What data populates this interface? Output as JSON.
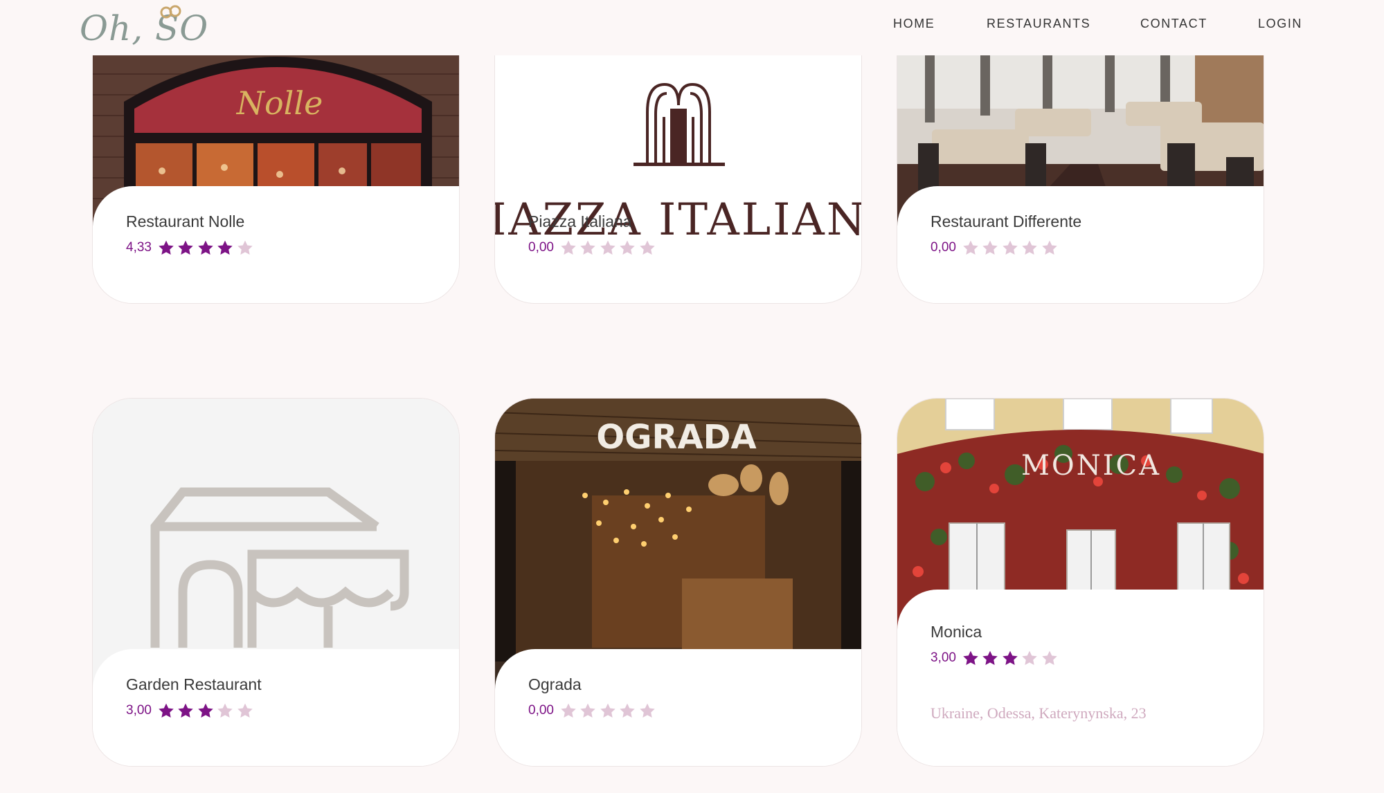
{
  "header": {
    "logo_text": "Oh, SO",
    "nav": [
      "HOME",
      "RESTAURANTS",
      "CONTACT",
      "LOGIN"
    ]
  },
  "colors": {
    "accent": "#7d1386",
    "star_filled": "#7d1386",
    "star_empty": "#e0c5d6",
    "background": "#fcf7f7"
  },
  "restaurants": [
    {
      "name": "Restaurant Nolle",
      "rating_text": "4,33",
      "stars_filled": 4,
      "image": "storefront-photo"
    },
    {
      "name": "Piazza Italiana",
      "rating_text": "0,00",
      "stars_filled": 0,
      "image": "logo",
      "logo_text": "PIAZZA ITALIANA"
    },
    {
      "name": "Restaurant Differente",
      "rating_text": "0,00",
      "stars_filled": 0,
      "image": "dining-room-photo"
    },
    {
      "name": "Garden Restaurant",
      "rating_text": "3,00",
      "stars_filled": 3,
      "image": "placeholder-icon"
    },
    {
      "name": "Ograda",
      "rating_text": "0,00",
      "stars_filled": 0,
      "image": "interior-photo",
      "sign_text": "OGRADA"
    },
    {
      "name": "Monica",
      "rating_text": "3,00",
      "stars_filled": 3,
      "image": "facade-photo",
      "sign_text": "MONICA",
      "address": "Ukraine, Odessa, Katerynynska, 23"
    }
  ]
}
